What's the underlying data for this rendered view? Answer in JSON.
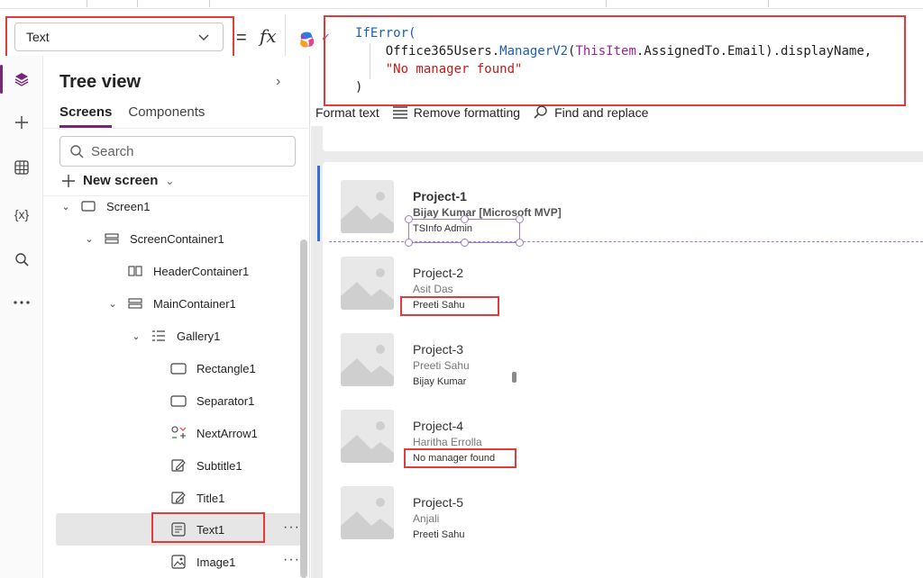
{
  "property_dropdown": {
    "value": "Text"
  },
  "formula_bar": {
    "equals": "=",
    "fx": "fx",
    "lines": [
      {
        "parts": [
          [
            "kw",
            "IfError("
          ]
        ]
      },
      {
        "parts": [
          [
            "plain",
            "    Office365Users."
          ],
          [
            "fn",
            "ManagerV2"
          ],
          [
            "plain",
            "("
          ],
          [
            "ref",
            "ThisItem"
          ],
          [
            "plain",
            ".AssignedTo.Email).displayName,"
          ]
        ]
      },
      {
        "parts": [
          [
            "str",
            "    \"No manager found\""
          ]
        ]
      },
      {
        "parts": [
          [
            "plain",
            ")"
          ]
        ]
      }
    ]
  },
  "toolbar": {
    "format_text": "Format text",
    "remove_formatting": "Remove formatting",
    "find_replace": "Find and replace"
  },
  "tree": {
    "title": "Tree view",
    "tabs": {
      "screens": "Screens",
      "components": "Components"
    },
    "search_placeholder": "Search",
    "new_screen": "New screen",
    "nodes": {
      "screen1": "Screen1",
      "screen_container": "ScreenContainer1",
      "header_container": "HeaderContainer1",
      "main_container": "MainContainer1",
      "gallery": "Gallery1",
      "rectangle": "Rectangle1",
      "separator": "Separator1",
      "next_arrow": "NextArrow1",
      "subtitle": "Subtitle1",
      "title": "Title1",
      "text1": "Text1",
      "image1": "Image1"
    }
  },
  "gallery": {
    "items": [
      {
        "title": "Project-1",
        "subtitle": "Bijay Kumar [Microsoft MVP]",
        "text": "TSInfo Admin"
      },
      {
        "title": "Project-2",
        "subtitle": "Asit Das",
        "text": "Preeti Sahu"
      },
      {
        "title": "Project-3",
        "subtitle": "Preeti Sahu",
        "text": "Bijay Kumar"
      },
      {
        "title": "Project-4",
        "subtitle": "Haritha Errolla",
        "text": "No manager found"
      },
      {
        "title": "Project-5",
        "subtitle": "Anjali",
        "text": "Preeti Sahu"
      }
    ]
  },
  "colors": {
    "accent": "#742774",
    "highlight_red": "#e03c3c",
    "selection_blue": "#2f6fd6",
    "selection_purple": "#9f7cc8"
  }
}
